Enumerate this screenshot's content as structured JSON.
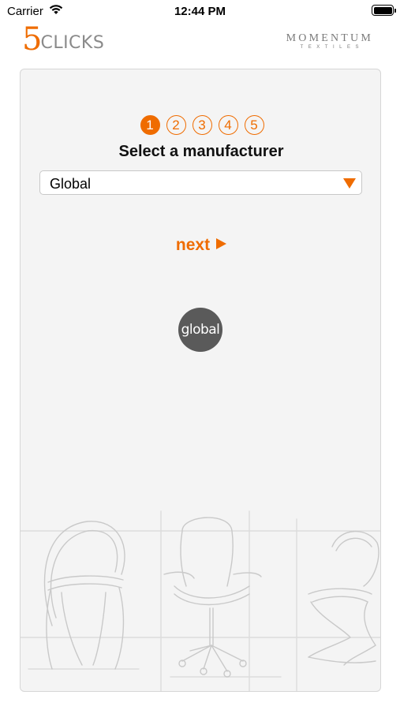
{
  "status_bar": {
    "carrier": "Carrier",
    "time": "12:44 PM"
  },
  "header": {
    "logo_five": "5",
    "logo_clicks": "CLICKS",
    "partner_logo_line1": "MOMENTUM",
    "partner_logo_line2": "TEXTILES"
  },
  "wizard": {
    "steps": [
      "1",
      "2",
      "3",
      "4",
      "5"
    ],
    "active_step": 1,
    "title": "Select a manufacturer",
    "manufacturer_select": {
      "value": "Global"
    },
    "next_label": "next",
    "brand_logo_text": "global"
  },
  "colors": {
    "accent": "#ef6c00",
    "card_background": "#f4f4f4",
    "brand_circle": "#5a5a5a"
  }
}
